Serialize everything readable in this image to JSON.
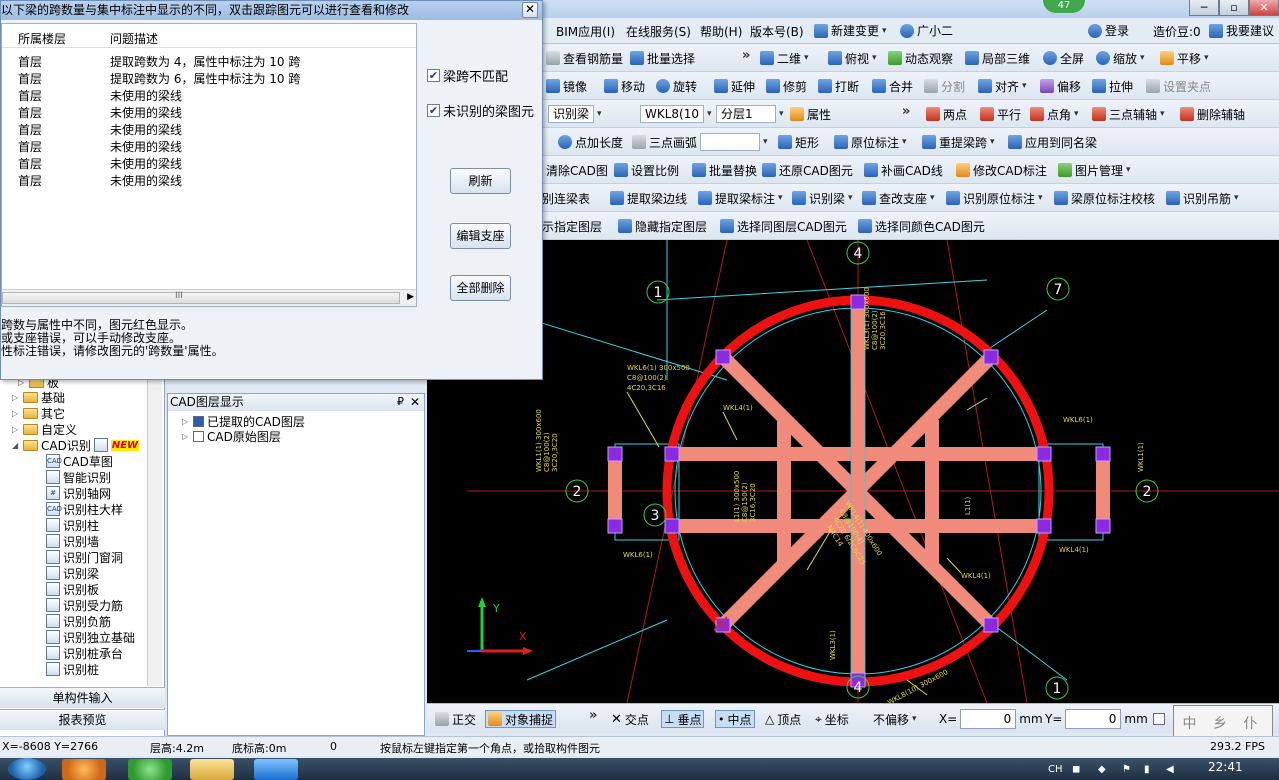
{
  "app": {
    "online_count": "47",
    "window_buttons": [
      "─",
      "▫",
      "✕"
    ]
  },
  "menubar": {
    "items": [
      "BIM应用(I)",
      "在线服务(S)",
      "帮助(H)",
      "版本号(B)",
      "新建变更",
      "广小二"
    ],
    "right": {
      "login": "登录",
      "price_bean": "造价豆:0",
      "suggest": "我要建议"
    }
  },
  "toolbar1": {
    "items": [
      "查看钢筋量",
      "批量选择",
      "二维",
      "俯视",
      "动态观察",
      "局部三维",
      "全屏",
      "缩放",
      "平移"
    ]
  },
  "toolbar2": {
    "items": [
      "镜像",
      "移动",
      "旋转",
      "延伸",
      "修剪",
      "打断",
      "合并",
      "分割",
      "对齐",
      "偏移",
      "拉伸",
      "设置夹点"
    ]
  },
  "toolbar3": {
    "type_select": "识别梁",
    "component_select": "WKL8(10",
    "layer_select": "分层1",
    "properties": "属性",
    "items": [
      "两点",
      "平行",
      "点角",
      "三点辅轴",
      "删除辅轴"
    ]
  },
  "toolbar4": {
    "items": [
      "点加长度",
      "三点画弧",
      "矩形",
      "原位标注",
      "重提梁跨",
      "应用到同名梁"
    ]
  },
  "toolbar5": {
    "items": [
      "清除CAD图",
      "设置比例",
      "批量替换",
      "还原CAD图元",
      "补画CAD线",
      "修改CAD标注",
      "图片管理"
    ]
  },
  "toolbar6": {
    "items": [
      "别连梁表",
      "提取梁边线",
      "提取梁标注",
      "识别梁",
      "查改支座",
      "识别原位标注",
      "梁原位标注校核",
      "识别吊筋"
    ]
  },
  "toolbar7": {
    "items": [
      "示指定图层",
      "隐藏指定图层",
      "选择同图层CAD图元",
      "选择同颜色CAD图元"
    ]
  },
  "dialog": {
    "title": "以下梁的跨数量与集中标注中显示的不同，双击跟踪图元可以进行查看和修改",
    "columns": [
      "所属楼层",
      "问题描述"
    ],
    "rows": [
      [
        "首层",
        "提取跨数为 4，属性中标注为 10 跨"
      ],
      [
        "首层",
        "提取跨数为 6，属性中标注为 10 跨"
      ],
      [
        "首层",
        "未使用的梁线"
      ],
      [
        "首层",
        "未使用的梁线"
      ],
      [
        "首层",
        "未使用的梁线"
      ],
      [
        "首层",
        "未使用的梁线"
      ],
      [
        "首层",
        "未使用的梁线"
      ],
      [
        "首层",
        "未使用的梁线"
      ]
    ],
    "check1": "梁跨不匹配",
    "check2": "未识别的梁图元",
    "btn_refresh": "刷新",
    "btn_edit": "编辑支座",
    "btn_delete": "全部删除",
    "scroll_mark": "III",
    "notes": [
      "跨数与属性中不同，图元红色显示。",
      "或支座错误，可以手动修改支座。",
      "性标注错误，请修改图元的'跨数量'属性。"
    ]
  },
  "tree": {
    "top_partial": "板",
    "items": [
      "基础",
      "其它",
      "自定义",
      "CAD识别"
    ],
    "new_badge": "NEW",
    "children": [
      "CAD草图",
      "智能识别",
      "识别轴网",
      "识别柱大样",
      "识别柱",
      "识别墙",
      "识别门窗洞",
      "识别梁",
      "识别板",
      "识别受力筋",
      "识别负筋",
      "识别独立基础",
      "识别桩承台",
      "识别桩"
    ],
    "btn_single": "单构件输入",
    "btn_report": "报表预览"
  },
  "layer_panel": {
    "title": "CAD图层显示",
    "pin": "₽",
    "close": "✕",
    "items": [
      "已提取的CAD图层",
      "CAD原始图层"
    ]
  },
  "canvas": {
    "axis_labels": [
      "4",
      "1",
      "7",
      "2",
      "3",
      "2",
      "4",
      "1"
    ],
    "annotations": [
      "WKL6(1) 300x500",
      "C8@100(2)",
      "4C20,3C16",
      "WKL3(1) 300x600",
      "C8@100(2)",
      "3C20,3C16",
      "WKL4(1)",
      "WKL6(1)",
      "WKL1(1) 300x600",
      "C8@100(2)",
      "3C20,3C20",
      "L1(1) 300x500",
      "C8@150(2)",
      "3C16,3C20",
      "WKL4(1) 400x600",
      "C8@100(4)",
      "4C20 6/2C6C25",
      "N4C14",
      "L1(1)",
      "WKL4(1)",
      "WKL3(1)",
      "WKL6(1)",
      "WKL1(1)",
      "WKL8(10) 300x600",
      "WKL4(1)"
    ],
    "ucs_x": "X",
    "ucs_y": "Y"
  },
  "snapbar": {
    "items": [
      "正交",
      "对象捕捉",
      "交点",
      "垂点",
      "中点",
      "顶点",
      "坐标"
    ],
    "offset_select": "不偏移",
    "x_label": "X=",
    "x_value": "0",
    "y_label": "Y=",
    "y_value": "0",
    "unit": "mm",
    "watermark": "中 乡 仆"
  },
  "status": {
    "coords": "X=-8608 Y=2766",
    "floor_height": "层高:4.2m",
    "base_height": "底标高:0m",
    "zero": "0",
    "hint": "按鼠标左键指定第一个角点，或拾取构件图元",
    "fps": "293.2 FPS"
  },
  "taskbar": {
    "clock": "22:41",
    "lang": "CH"
  }
}
